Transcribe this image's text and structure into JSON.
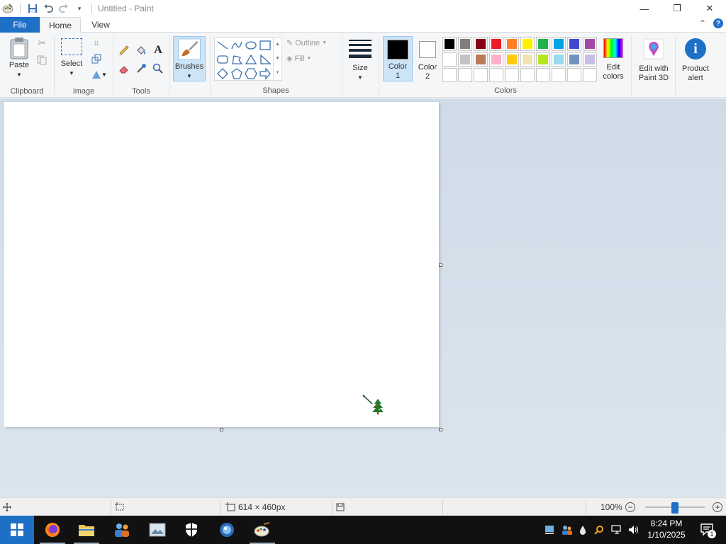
{
  "window": {
    "title": "Untitled - Paint"
  },
  "tabs": {
    "file": "File",
    "home": "Home",
    "view": "View"
  },
  "ribbon": {
    "clipboard": {
      "paste": "Paste",
      "group": "Clipboard"
    },
    "image": {
      "select": "Select",
      "group": "Image"
    },
    "tools": {
      "group": "Tools"
    },
    "brushes": {
      "label": "Brushes"
    },
    "shapes": {
      "outline": "Outline",
      "fill": "Fill",
      "group": "Shapes"
    },
    "size": {
      "label": "Size"
    },
    "colors": {
      "color1_line1": "Color",
      "color1_line2": "1",
      "color2_line1": "Color",
      "color2_line2": "2",
      "group": "Colors",
      "edit_line1": "Edit",
      "edit_line2": "colors",
      "color1": "#000000",
      "color2": "#ffffff",
      "palette_row1": [
        "#000000",
        "#7f7f7f",
        "#880015",
        "#ed1c24",
        "#ff7f27",
        "#fff200",
        "#22b14c",
        "#00a2e8",
        "#3f48cc",
        "#a349a4"
      ],
      "palette_row2": [
        "#ffffff",
        "#c3c3c3",
        "#b97a57",
        "#ffaec9",
        "#ffc90e",
        "#efe4b0",
        "#b5e61d",
        "#99d9ea",
        "#7092be",
        "#c8bfe7"
      ]
    },
    "paint3d": {
      "line1": "Edit with",
      "line2": "Paint 3D"
    },
    "product_alert": {
      "line1": "Product",
      "line2": "alert"
    }
  },
  "status": {
    "dimensions": "614 × 460px",
    "zoom": "100%",
    "zoom_level": 0.5
  },
  "taskbar": {
    "time": "8:24 PM",
    "date": "1/10/2025",
    "notifications": "1"
  }
}
